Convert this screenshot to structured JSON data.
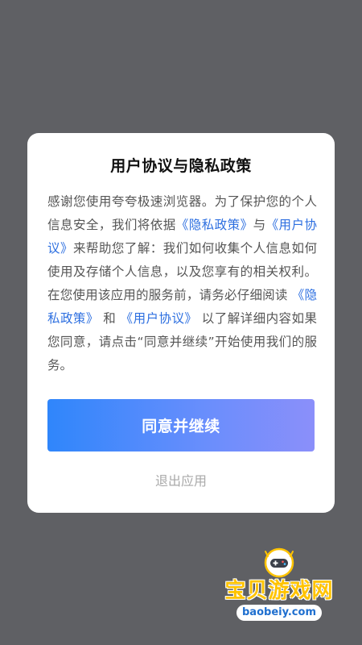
{
  "dialog": {
    "title": "用户协议与隐私政策",
    "text_1": "感谢您使用夸夸极速浏览器。为了保护您的个人信息安全，我们将依据",
    "privacy_link_1": "《隐私政策》",
    "text_2": "与",
    "user_link_1": "《用户协议》",
    "text_3": "来帮助您了解：我们如何收集个人信息如何使用及存储个人信息，以及您享有的相关权利。在您使用该应用的服务前，请务必仔细阅读 ",
    "privacy_link_2": "《隐私政策》",
    "text_4": " 和 ",
    "user_link_2": "《用户协议》",
    "text_5": " 以了解详细内容如果您同意，请点击“同意并继续”开始使用我们的服务。",
    "agree_label": "同意并继续",
    "exit_label": "退出应用"
  },
  "watermark": {
    "site_name": "宝贝游戏网",
    "url": "baobeiy.com"
  },
  "colors": {
    "overlay": "#5f6064",
    "link": "#2d6fe0",
    "button_start": "#2f86fb",
    "button_end": "#8b8ffa",
    "watermark_gold": "#ffc300"
  }
}
